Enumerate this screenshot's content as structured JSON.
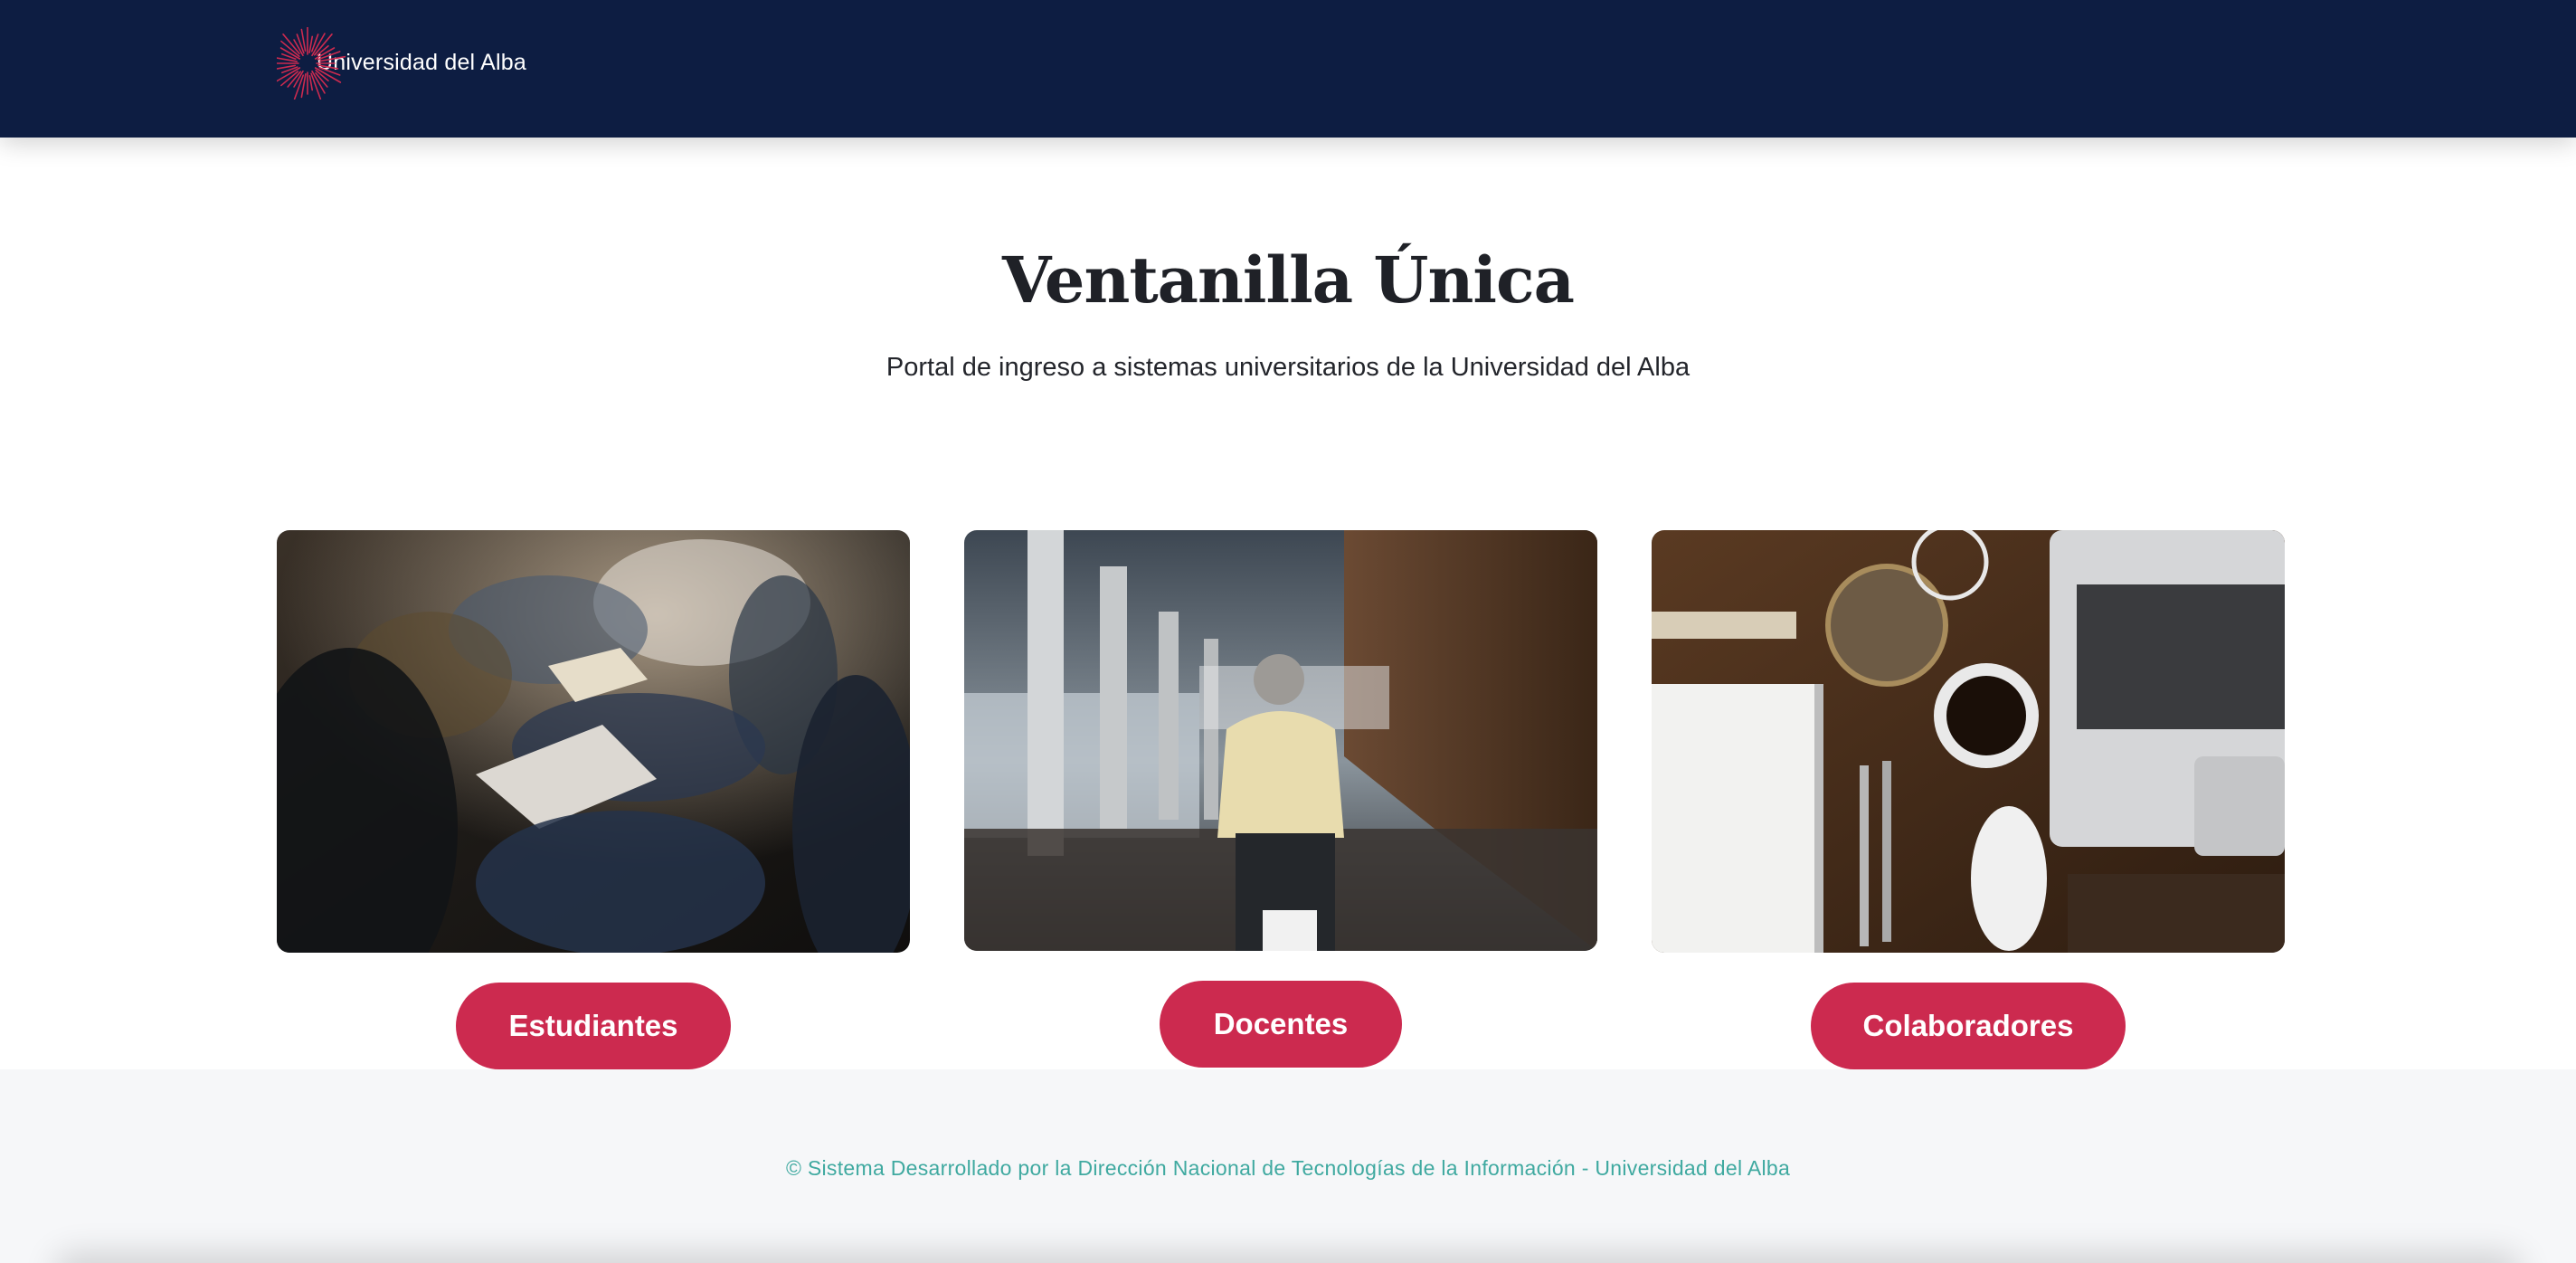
{
  "header": {
    "brand_name": "Universidad del Alba",
    "background_color": "#0d1d42",
    "logo_color": "#cc2a4f"
  },
  "hero": {
    "title": "Ventanilla Única",
    "subtitle": "Portal de ingreso a sistemas universitarios de la Universidad del Alba"
  },
  "cards": [
    {
      "button_label": "Estudiantes",
      "image_icon": "students-classroom-photo"
    },
    {
      "button_label": "Docentes",
      "image_icon": "teacher-hallway-photo"
    },
    {
      "button_label": "Colaboradores",
      "image_icon": "desk-workspace-photo"
    }
  ],
  "footer": {
    "text": "© Sistema Desarrollado por la Dirección Nacional de Tecnologías de la Información - Universidad del Alba"
  },
  "colors": {
    "accent": "#cc2a4f",
    "footer_text": "#3fa9a0"
  }
}
